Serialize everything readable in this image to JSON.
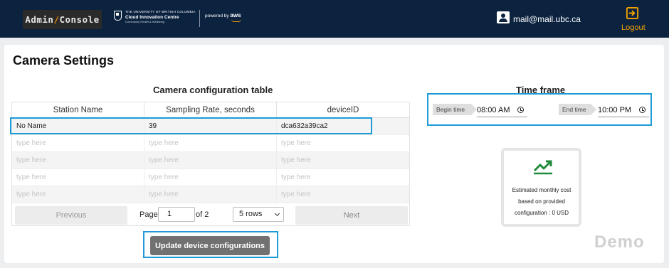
{
  "header": {
    "brand_left": "Admin",
    "brand_sep": "/",
    "brand_right": "Console",
    "ubc_line1": "THE UNIVERSITY OF BRITISH COLUMBIA",
    "ubc_line2": "Cloud Innovation Centre",
    "ubc_line3": "Community Health & Wellbeing",
    "powered_by": "powered by",
    "aws": "aws",
    "user_email": "mail@mail.ubc.ca",
    "logout": "Logout"
  },
  "page": {
    "title": "Camera Settings",
    "demo_watermark": "Demo"
  },
  "table": {
    "title": "Camera configuration table",
    "columns": [
      "Station Name",
      "Sampling Rate, seconds",
      "deviceID"
    ],
    "rows": [
      [
        "No Name",
        "39",
        "dca632a39ca2"
      ],
      [
        "type here",
        "type here",
        "type here"
      ],
      [
        "type here",
        "type here",
        "type here"
      ],
      [
        "type here",
        "type here",
        "type here"
      ],
      [
        "type here",
        "type here",
        "type here"
      ]
    ]
  },
  "pagination": {
    "previous": "Previous",
    "next": "Next",
    "page_label": "Page",
    "page_value": "1",
    "of_label": "of 2",
    "rows_selected": "5 rows"
  },
  "actions": {
    "update": "Update device configurations"
  },
  "time_frame": {
    "title": "Time frame",
    "begin_label": "Begin time",
    "begin_value": "08:00 AM",
    "end_label": "End time",
    "end_value": "10:00 PM"
  },
  "cost": {
    "line1": "Estimated monthly cost",
    "line2": "based on provided",
    "line3": "configuration : 0 USD",
    "icon": "trending-up-icon",
    "icon_color": "#1f8a3a"
  },
  "colors": {
    "header_bg": "#0c2340",
    "highlight": "#1e9bd7",
    "logout": "#f0a000"
  }
}
